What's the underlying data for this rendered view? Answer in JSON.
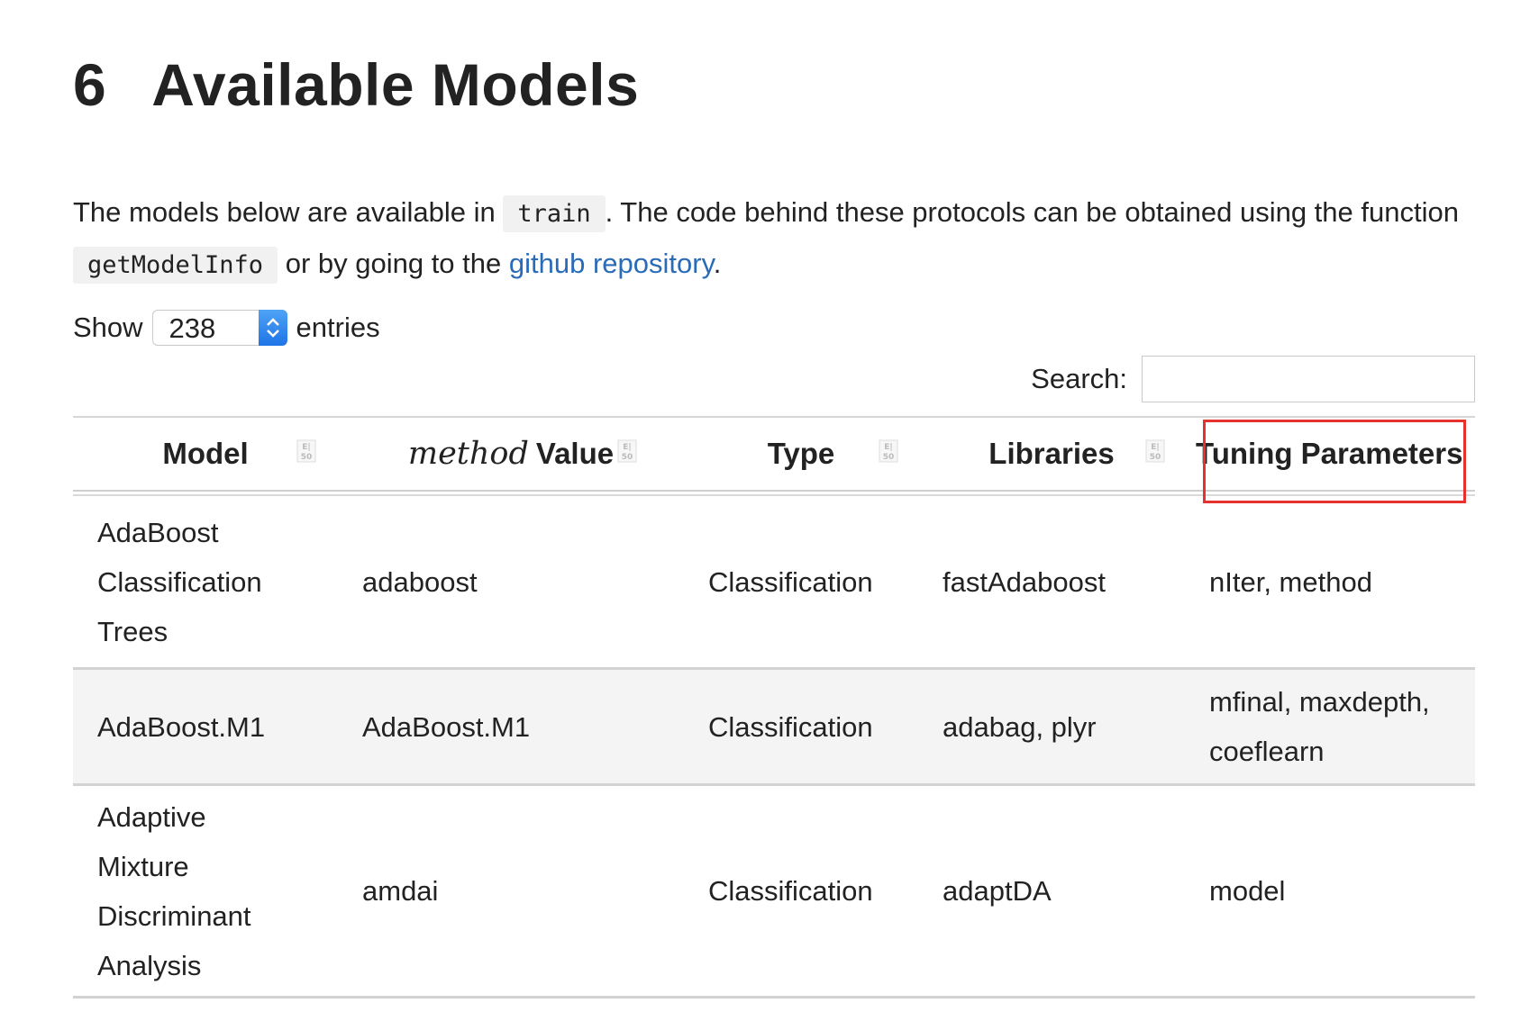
{
  "heading": {
    "number": "6",
    "title": "Available Models"
  },
  "intro": {
    "text1": "The models below are available in",
    "code1": "train",
    "text2": ". The code behind these protocols can be obtained using the function",
    "code2": "getModelInfo",
    "text3": "or by going to the",
    "link": "github repository",
    "text4": "."
  },
  "length": {
    "show": "Show",
    "value": "238",
    "entries": "entries"
  },
  "search": {
    "label": "Search:",
    "value": ""
  },
  "table": {
    "headers": {
      "model": "Model",
      "method_italic": "method",
      "method_rest": "Value",
      "type": "Type",
      "libraries": "Libraries",
      "tuning": "Tuning Parameters"
    },
    "rows": [
      {
        "model": "AdaBoost Classification Trees",
        "method": "adaboost",
        "type": "Classification",
        "libraries": "fastAdaboost",
        "tuning": "nIter, method"
      },
      {
        "model": "AdaBoost.M1",
        "method": "AdaBoost.M1",
        "type": "Classification",
        "libraries": "adabag, plyr",
        "tuning": "mfinal, maxdepth, coeflearn"
      },
      {
        "model": "Adaptive Mixture Discriminant Analysis",
        "method": "amdai",
        "type": "Classification",
        "libraries": "adaptDA",
        "tuning": "model"
      }
    ]
  },
  "colors": {
    "link": "#2a6bb8",
    "highlight": "#e5322c",
    "select_button": "#1e74e6"
  }
}
